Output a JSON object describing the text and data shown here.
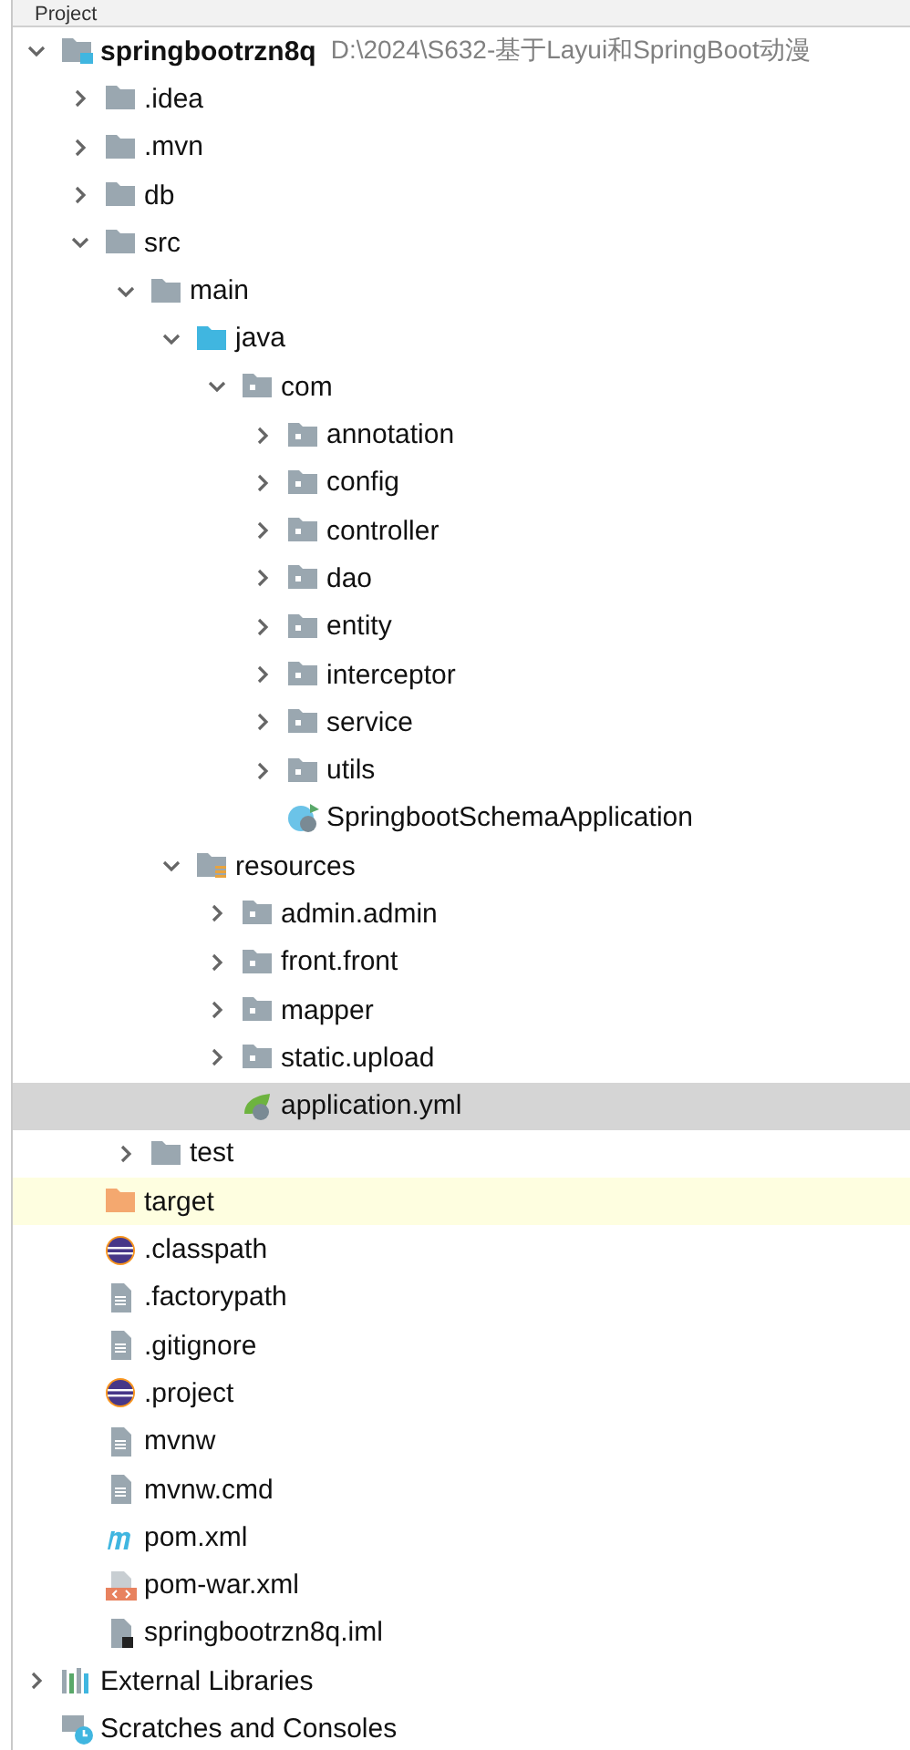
{
  "panel": {
    "title": "Project"
  },
  "tree": [
    {
      "label": "springbootrzn8q",
      "path": "D:\\2024\\S632-基于Layui和SpringBoot动漫",
      "kind": "module",
      "expanded": true,
      "selected": false,
      "highlighted": false,
      "children": [
        {
          "label": ".idea",
          "kind": "folder",
          "expanded": false,
          "selected": false,
          "highlighted": false
        },
        {
          "label": ".mvn",
          "kind": "folder",
          "expanded": false,
          "selected": false,
          "highlighted": false
        },
        {
          "label": "db",
          "kind": "folder",
          "expanded": false,
          "selected": false,
          "highlighted": false
        },
        {
          "label": "src",
          "kind": "folder",
          "expanded": true,
          "selected": false,
          "highlighted": false,
          "children": [
            {
              "label": "main",
              "kind": "folder",
              "expanded": true,
              "selected": false,
              "highlighted": false,
              "children": [
                {
                  "label": "java",
                  "kind": "source-folder",
                  "expanded": true,
                  "selected": false,
                  "highlighted": false,
                  "children": [
                    {
                      "label": "com",
                      "kind": "package",
                      "expanded": true,
                      "selected": false,
                      "highlighted": false,
                      "children": [
                        {
                          "label": "annotation",
                          "kind": "package",
                          "expanded": false,
                          "selected": false,
                          "highlighted": false
                        },
                        {
                          "label": "config",
                          "kind": "package",
                          "expanded": false,
                          "selected": false,
                          "highlighted": false
                        },
                        {
                          "label": "controller",
                          "kind": "package",
                          "expanded": false,
                          "selected": false,
                          "highlighted": false
                        },
                        {
                          "label": "dao",
                          "kind": "package",
                          "expanded": false,
                          "selected": false,
                          "highlighted": false
                        },
                        {
                          "label": "entity",
                          "kind": "package",
                          "expanded": false,
                          "selected": false,
                          "highlighted": false
                        },
                        {
                          "label": "interceptor",
                          "kind": "package",
                          "expanded": false,
                          "selected": false,
                          "highlighted": false
                        },
                        {
                          "label": "service",
                          "kind": "package",
                          "expanded": false,
                          "selected": false,
                          "highlighted": false
                        },
                        {
                          "label": "utils",
                          "kind": "package",
                          "expanded": false,
                          "selected": false,
                          "highlighted": false
                        },
                        {
                          "label": "SpringbootSchemaApplication",
                          "kind": "spring-class",
                          "selected": false,
                          "highlighted": false
                        }
                      ]
                    }
                  ]
                },
                {
                  "label": "resources",
                  "kind": "resource-folder",
                  "expanded": true,
                  "selected": false,
                  "highlighted": false,
                  "children": [
                    {
                      "label": "admin.admin",
                      "kind": "package",
                      "expanded": false,
                      "selected": false,
                      "highlighted": false
                    },
                    {
                      "label": "front.front",
                      "kind": "package",
                      "expanded": false,
                      "selected": false,
                      "highlighted": false
                    },
                    {
                      "label": "mapper",
                      "kind": "package",
                      "expanded": false,
                      "selected": false,
                      "highlighted": false
                    },
                    {
                      "label": "static.upload",
                      "kind": "package",
                      "expanded": false,
                      "selected": false,
                      "highlighted": false
                    },
                    {
                      "label": "application.yml",
                      "kind": "spring-config",
                      "selected": true,
                      "highlighted": false
                    }
                  ]
                }
              ]
            },
            {
              "label": "test",
              "kind": "folder",
              "expanded": false,
              "selected": false,
              "highlighted": false
            }
          ]
        },
        {
          "label": "target",
          "kind": "excluded-folder",
          "selected": false,
          "highlighted": true
        },
        {
          "label": ".classpath",
          "kind": "eclipse",
          "selected": false,
          "highlighted": false
        },
        {
          "label": ".factorypath",
          "kind": "text-file",
          "selected": false,
          "highlighted": false
        },
        {
          "label": ".gitignore",
          "kind": "text-file",
          "selected": false,
          "highlighted": false
        },
        {
          "label": ".project",
          "kind": "eclipse",
          "selected": false,
          "highlighted": false
        },
        {
          "label": "mvnw",
          "kind": "text-file",
          "selected": false,
          "highlighted": false
        },
        {
          "label": "mvnw.cmd",
          "kind": "text-file",
          "selected": false,
          "highlighted": false
        },
        {
          "label": "pom.xml",
          "kind": "maven",
          "selected": false,
          "highlighted": false
        },
        {
          "label": "pom-war.xml",
          "kind": "xml",
          "selected": false,
          "highlighted": false
        },
        {
          "label": "springbootrzn8q.iml",
          "kind": "iml",
          "selected": false,
          "highlighted": false
        }
      ]
    },
    {
      "label": "External Libraries",
      "kind": "libraries",
      "expanded": false,
      "selected": false,
      "highlighted": false
    },
    {
      "label": "Scratches and Consoles",
      "kind": "scratches",
      "selected": false,
      "highlighted": false
    }
  ]
}
